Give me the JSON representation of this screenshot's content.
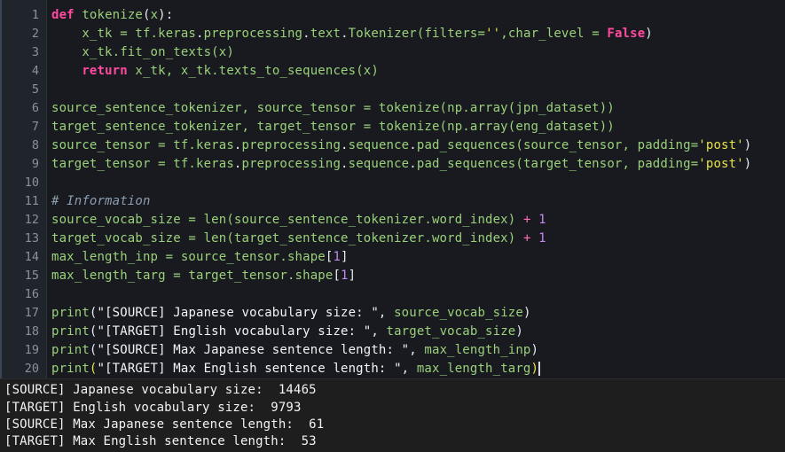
{
  "editor": {
    "line_numbers": [
      "1",
      "2",
      "3",
      "4",
      "5",
      "6",
      "7",
      "8",
      "9",
      "10",
      "11",
      "12",
      "13",
      "14",
      "15",
      "16",
      "17",
      "18",
      "19",
      "20"
    ],
    "l1": {
      "a": "def",
      "b": " ",
      "c": "tokenize",
      "d": "(",
      "e": "x",
      "f": "):"
    },
    "l2": {
      "a": "    x_tk = tf.",
      "b": "keras",
      "c": ".",
      "d": "preprocessing",
      "e": ".",
      "f": "text",
      "g": ".",
      "h": "Tokenizer",
      "i": "(filters=",
      "j": "''",
      "k": ",char_level = ",
      "l": "False",
      "m": ")"
    },
    "l3": {
      "a": "    x_tk.",
      "b": "fit_on_texts",
      "c": "(x)"
    },
    "l4": {
      "a": "    ",
      "b": "return",
      "c": " x_tk, x_tk.",
      "d": "texts_to_sequences",
      "e": "(x)"
    },
    "l6": {
      "a": "source_sentence_tokenizer, source_tensor = ",
      "b": "tokenize",
      "c": "(np.",
      "d": "array",
      "e": "(jpn_dataset))"
    },
    "l7": {
      "a": "target_sentence_tokenizer, target_tensor = ",
      "b": "tokenize",
      "c": "(np.",
      "d": "array",
      "e": "(eng_dataset))"
    },
    "l8": {
      "a": "source_tensor = tf.",
      "b": "keras",
      "c": ".",
      "d": "preprocessing",
      "e": ".",
      "f": "sequence",
      "g": ".",
      "h": "pad_sequences",
      "i": "(source_tensor, padding=",
      "j": "'post'",
      "k": ")"
    },
    "l9": {
      "a": "target_tensor = tf.",
      "b": "keras",
      "c": ".",
      "d": "preprocessing",
      "e": ".",
      "f": "sequence",
      "g": ".",
      "h": "pad_sequences",
      "i": "(target_tensor, padding=",
      "j": "'post'",
      "k": ")"
    },
    "l11": {
      "a": "# Information"
    },
    "l12": {
      "a": "source_vocab_size = ",
      "b": "len",
      "c": "(source_sentence_tokenizer.",
      "d": "word_index",
      "e": ") ",
      "f": "+",
      "g": " ",
      "h": "1"
    },
    "l13": {
      "a": "target_vocab_size = ",
      "b": "len",
      "c": "(target_sentence_tokenizer.",
      "d": "word_index",
      "e": ") ",
      "f": "+",
      "g": " ",
      "h": "1"
    },
    "l14": {
      "a": "max_length_inp = source_tensor.",
      "b": "shape",
      "c": "[",
      "d": "1",
      "e": "]"
    },
    "l15": {
      "a": "max_length_targ = target_tensor.",
      "b": "shape",
      "c": "[",
      "d": "1",
      "e": "]"
    },
    "l17": {
      "a": "print",
      "b": "(",
      "c": "\"[SOURCE] Japanese vocabulary size: \"",
      "d": ", ",
      "e": "source_vocab_size",
      "f": ")"
    },
    "l18": {
      "a": "print",
      "b": "(",
      "c": "\"[TARGET] English vocabulary size: \"",
      "d": ", ",
      "e": "target_vocab_size",
      "f": ")"
    },
    "l19": {
      "a": "print",
      "b": "(",
      "c": "\"[SOURCE] Max Japanese sentence length: \"",
      "d": ", ",
      "e": "max_length_inp",
      "f": ")"
    },
    "l20": {
      "a": "print",
      "b": "(",
      "c": "\"[TARGET] Max English sentence length: \"",
      "d": ", ",
      "e": "max_length_targ",
      "f": ")"
    }
  },
  "output": {
    "lines": [
      "[SOURCE] Japanese vocabulary size:  14465",
      "[TARGET] English vocabulary size:  9793",
      "[SOURCE] Max Japanese sentence length:  61",
      "[TARGET] Max English sentence length:  53"
    ]
  },
  "colors": {
    "background": "#181a1f",
    "keyword": "#ff4aa0",
    "function": "#9ad17a",
    "number": "#c18af0",
    "comment": "#8c9eb0"
  }
}
